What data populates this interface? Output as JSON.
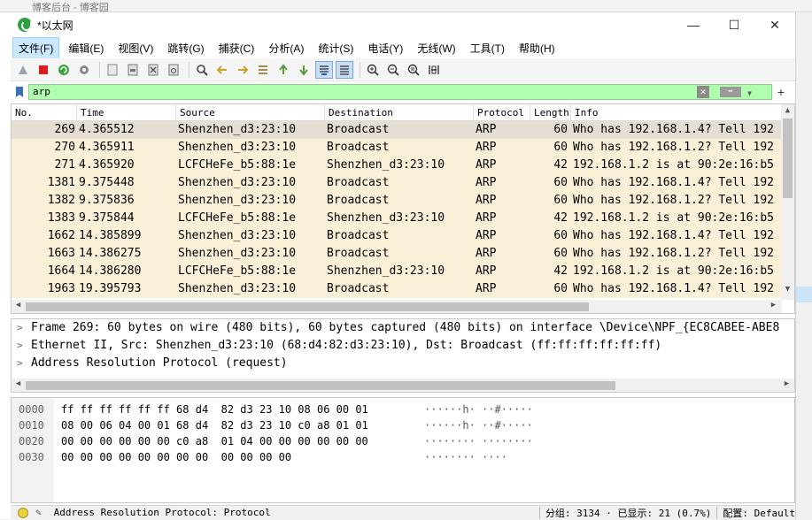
{
  "window": {
    "title": "*以太网",
    "bg_hint": "博客后台 - 博客园"
  },
  "window_buttons": {
    "minimize": "—",
    "maximize": "☐",
    "close": "✕"
  },
  "menu": [
    "文件(F)",
    "编辑(E)",
    "视图(V)",
    "跳转(G)",
    "捕获(C)",
    "分析(A)",
    "统计(S)",
    "电话(Y)",
    "无线(W)",
    "工具(T)",
    "帮助(H)"
  ],
  "filter": {
    "value": "arp"
  },
  "packet_list": {
    "columns": [
      "No.",
      "Time",
      "Source",
      "Destination",
      "Protocol",
      "Length",
      "Info"
    ],
    "rows": [
      {
        "no": "269",
        "time": "4.365512",
        "src": "Shenzhen_d3:23:10",
        "dst": "Broadcast",
        "proto": "ARP",
        "len": "60",
        "info": "Who has 192.168.1.4? Tell 192"
      },
      {
        "no": "270",
        "time": "4.365911",
        "src": "Shenzhen_d3:23:10",
        "dst": "Broadcast",
        "proto": "ARP",
        "len": "60",
        "info": "Who has 192.168.1.2? Tell 192"
      },
      {
        "no": "271",
        "time": "4.365920",
        "src": "LCFCHeFe_b5:88:1e",
        "dst": "Shenzhen_d3:23:10",
        "proto": "ARP",
        "len": "42",
        "info": "192.168.1.2 is at 90:2e:16:b5"
      },
      {
        "no": "1381",
        "time": "9.375448",
        "src": "Shenzhen_d3:23:10",
        "dst": "Broadcast",
        "proto": "ARP",
        "len": "60",
        "info": "Who has 192.168.1.4? Tell 192"
      },
      {
        "no": "1382",
        "time": "9.375836",
        "src": "Shenzhen_d3:23:10",
        "dst": "Broadcast",
        "proto": "ARP",
        "len": "60",
        "info": "Who has 192.168.1.2? Tell 192"
      },
      {
        "no": "1383",
        "time": "9.375844",
        "src": "LCFCHeFe_b5:88:1e",
        "dst": "Shenzhen_d3:23:10",
        "proto": "ARP",
        "len": "42",
        "info": "192.168.1.2 is at 90:2e:16:b5"
      },
      {
        "no": "1662",
        "time": "14.385899",
        "src": "Shenzhen_d3:23:10",
        "dst": "Broadcast",
        "proto": "ARP",
        "len": "60",
        "info": "Who has 192.168.1.4? Tell 192"
      },
      {
        "no": "1663",
        "time": "14.386275",
        "src": "Shenzhen_d3:23:10",
        "dst": "Broadcast",
        "proto": "ARP",
        "len": "60",
        "info": "Who has 192.168.1.2? Tell 192"
      },
      {
        "no": "1664",
        "time": "14.386280",
        "src": "LCFCHeFe_b5:88:1e",
        "dst": "Shenzhen_d3:23:10",
        "proto": "ARP",
        "len": "42",
        "info": "192.168.1.2 is at 90:2e:16:b5"
      },
      {
        "no": "1963",
        "time": "19.395793",
        "src": "Shenzhen_d3:23:10",
        "dst": "Broadcast",
        "proto": "ARP",
        "len": "60",
        "info": "Who has 192.168.1.4? Tell 192"
      }
    ],
    "selected_row": 0,
    "row_color": "#faf0d7",
    "selected_color": "#e4dfd2"
  },
  "details": [
    "Frame 269: 60 bytes on wire (480 bits), 60 bytes captured (480 bits) on interface \\Device\\NPF_{EC8CABEE-ABE8",
    "Ethernet II, Src: Shenzhen_d3:23:10 (68:d4:82:d3:23:10), Dst: Broadcast (ff:ff:ff:ff:ff:ff)",
    "Address Resolution Protocol (request)"
  ],
  "bytes": [
    {
      "offset": "0000",
      "hex": "ff ff ff ff ff ff 68 d4  82 d3 23 10 08 06 00 01",
      "ascii": "······h· ··#·····"
    },
    {
      "offset": "0010",
      "hex": "08 00 06 04 00 01 68 d4  82 d3 23 10 c0 a8 01 01",
      "ascii": "······h· ··#·····"
    },
    {
      "offset": "0020",
      "hex": "00 00 00 00 00 00 c0 a8  01 04 00 00 00 00 00 00",
      "ascii": "········ ········"
    },
    {
      "offset": "0030",
      "hex": "00 00 00 00 00 00 00 00  00 00 00 00",
      "ascii": "········ ····"
    }
  ],
  "status": {
    "text": "Address Resolution Protocol: Protocol",
    "packets": "分组: 3134 · 已显示: 21 (0.7%)",
    "profile": "配置: Default"
  },
  "colors": {
    "filter_ok": "#afffaf",
    "accent": "#cce8ff"
  }
}
